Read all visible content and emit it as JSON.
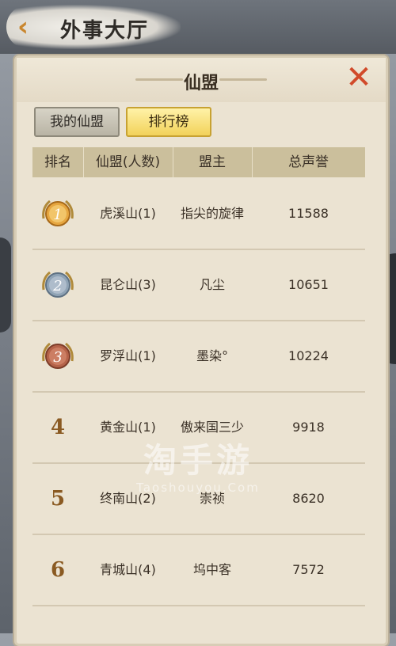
{
  "header": {
    "back_icon": "chevron-left-icon",
    "title": "外事大厅"
  },
  "panel": {
    "title": "仙盟",
    "close_icon": "close-icon",
    "tabs": [
      {
        "label": "我的仙盟",
        "active": false
      },
      {
        "label": "排行榜",
        "active": true
      }
    ],
    "columns": [
      "排名",
      "仙盟(人数)",
      "盟主",
      "总声誉"
    ],
    "rows": [
      {
        "rank": "1",
        "medal": "gold-medal-icon",
        "guild": "虎溪山(1)",
        "leader": "指尖的旋律",
        "fame": "11588"
      },
      {
        "rank": "2",
        "medal": "silver-medal-icon",
        "guild": "昆仑山(3)",
        "leader": "凡尘",
        "fame": "10651"
      },
      {
        "rank": "3",
        "medal": "bronze-medal-icon",
        "guild": "罗浮山(1)",
        "leader": "墨染°",
        "fame": "10224"
      },
      {
        "rank": "4",
        "guild": "黄金山(1)",
        "leader": "傲来国三少",
        "fame": "9918"
      },
      {
        "rank": "5",
        "guild": "终南山(2)",
        "leader": "崇祯",
        "fame": "8620"
      },
      {
        "rank": "6",
        "guild": "青城山(4)",
        "leader": "坞中客",
        "fame": "7572"
      }
    ]
  },
  "watermark": {
    "main": "淘手游",
    "sub": "Taoshouyou.Com"
  },
  "colors": {
    "accent": "#f2d25a",
    "close": "#d14a2a",
    "panel_bg": "#ebe3d2",
    "header_bg": "#cbbf9c"
  }
}
